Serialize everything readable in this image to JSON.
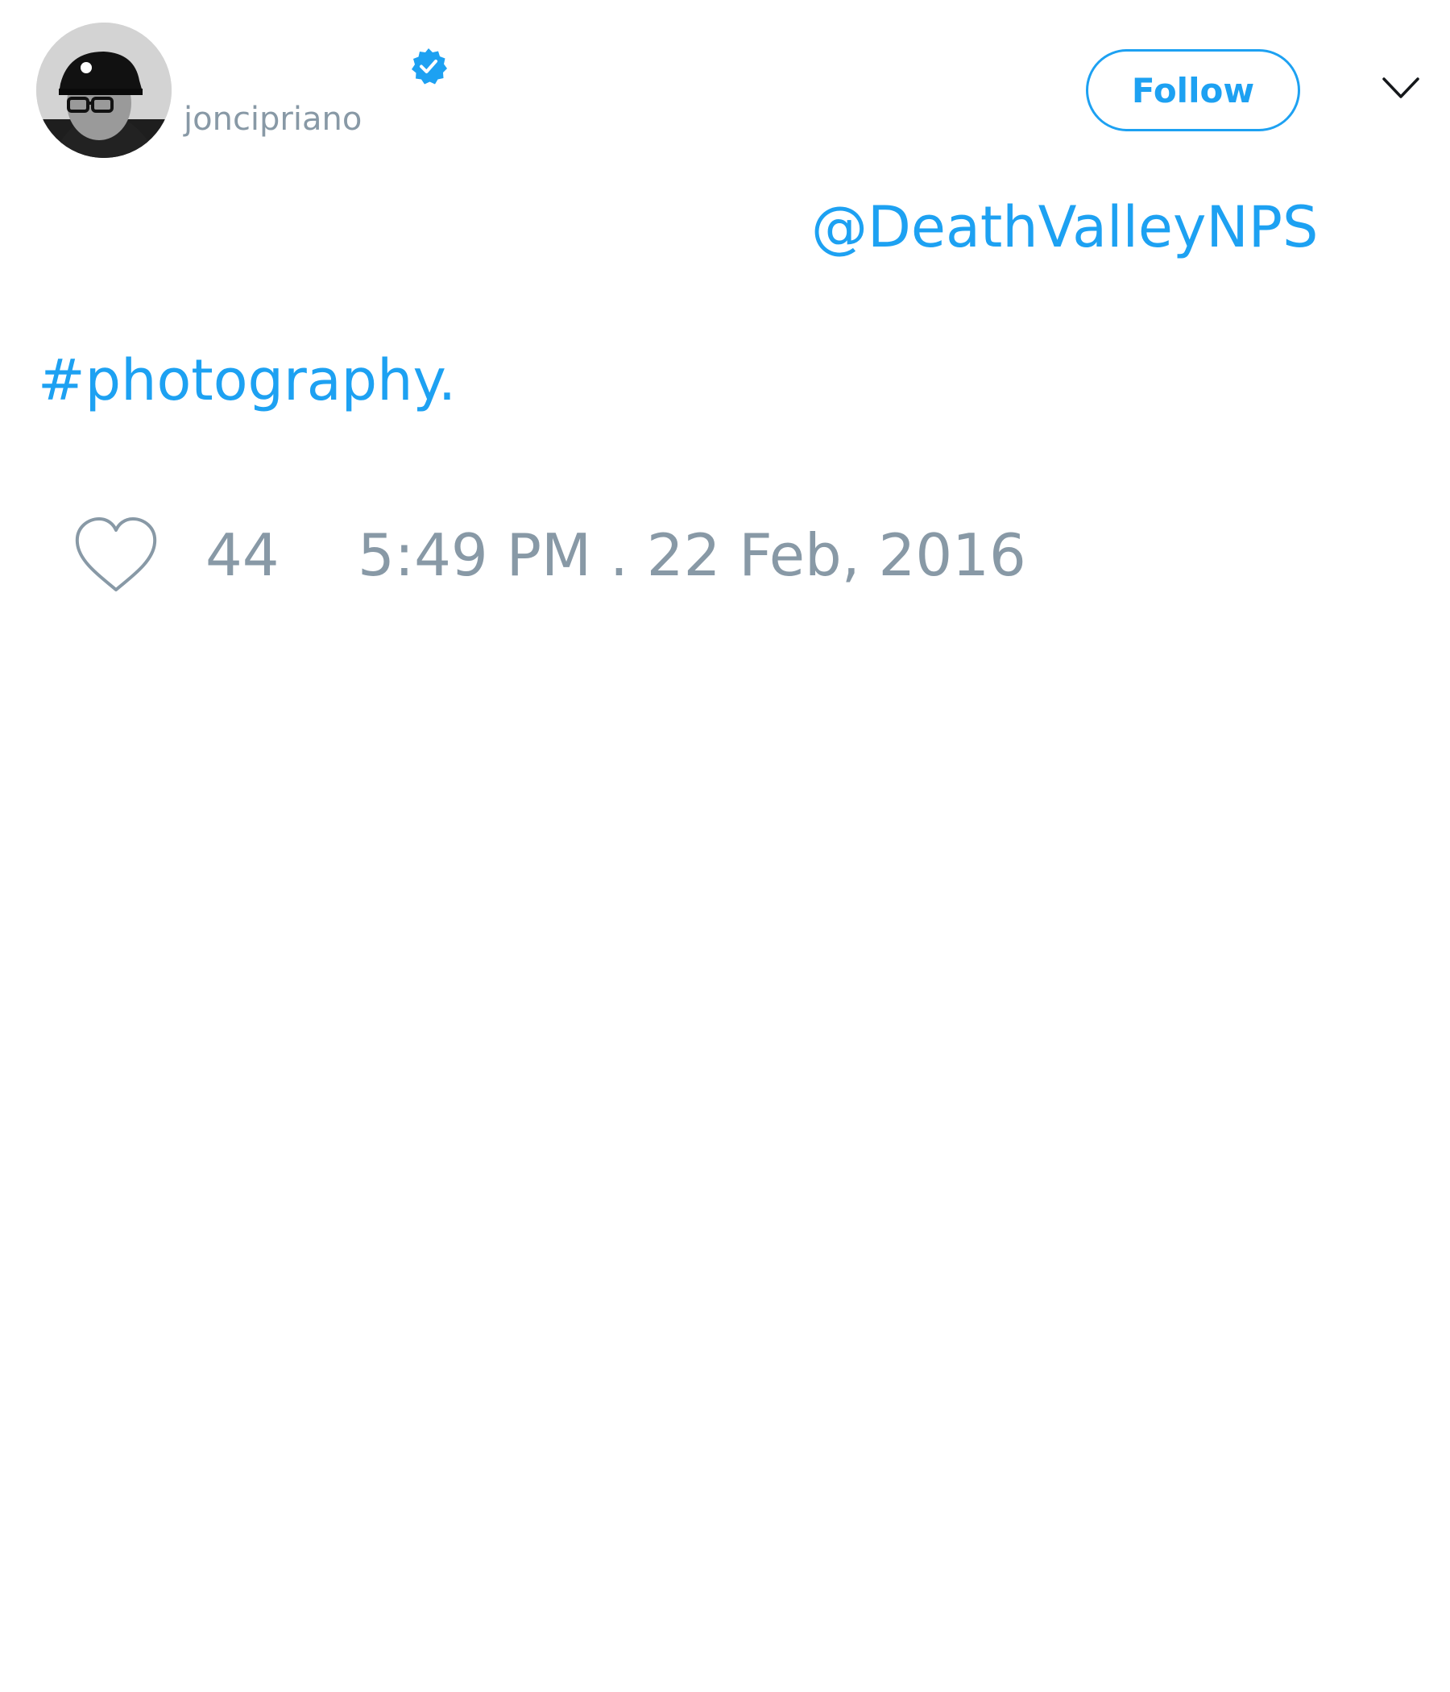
{
  "header": {
    "display_name": "",
    "handle": "joncipriano",
    "verified": true,
    "follow_label": "Follow",
    "menu_icon": "chevron-down-icon"
  },
  "tweet": {
    "mention": "@DeathValleyNPS",
    "hashtag": "#photography."
  },
  "footer": {
    "like_icon": "heart-icon",
    "like_count": "44",
    "timestamp": "5:49 PM . 22 Feb, 2016"
  },
  "colors": {
    "accent": "#1da1f2",
    "muted": "#8899a6",
    "background": "#ffffff"
  }
}
